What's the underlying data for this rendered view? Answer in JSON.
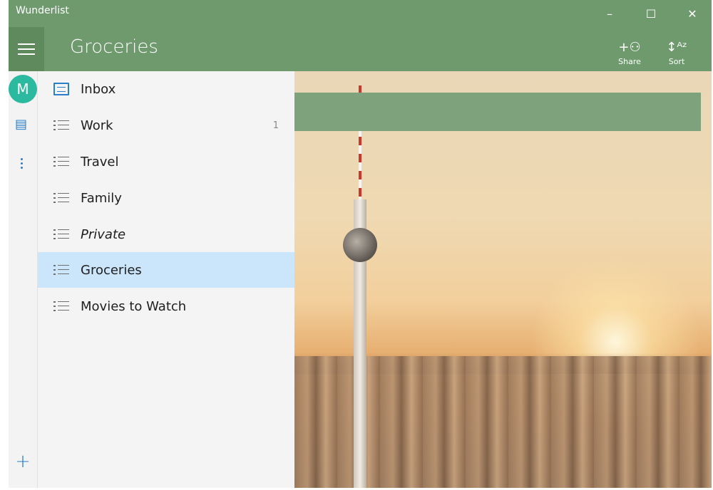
{
  "window": {
    "title": "Wunderlist",
    "controls": {
      "minimize": "–",
      "maximize": "☐",
      "close": "✕"
    }
  },
  "header": {
    "list_title": "Groceries",
    "actions": [
      {
        "label": "Share",
        "icon": "share-person-icon"
      },
      {
        "label": "Sort",
        "icon": "sort-az-icon"
      }
    ]
  },
  "rail": {
    "avatar_letter": "M",
    "add_symbol": "+"
  },
  "sidebar": {
    "items": [
      {
        "label": "Inbox",
        "icon": "inbox-icon",
        "count": ""
      },
      {
        "label": "Work",
        "icon": "list-icon",
        "count": "1"
      },
      {
        "label": "Travel",
        "icon": "list-icon",
        "count": ""
      },
      {
        "label": "Family",
        "icon": "list-icon",
        "count": ""
      },
      {
        "label": "Private",
        "icon": "list-icon",
        "count": ""
      },
      {
        "label": "Groceries",
        "icon": "list-icon",
        "count": "",
        "selected": true
      },
      {
        "label": "Movies to Watch",
        "icon": "list-icon",
        "count": ""
      }
    ]
  },
  "colors": {
    "header": "#6f9a6e",
    "avatar": "#2bb9a0",
    "accent": "#2a7fc9",
    "selected": "#cbe6fb"
  }
}
